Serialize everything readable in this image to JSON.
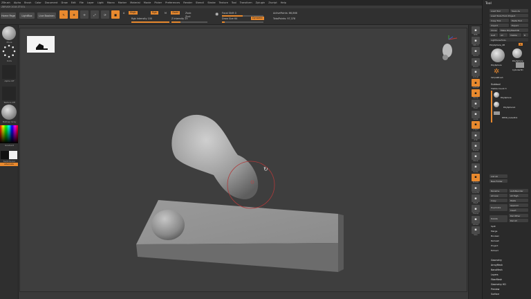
{
  "menu": [
    "ZBrush",
    "Alpha",
    "Brush",
    "Color",
    "Document",
    "Draw",
    "Edit",
    "File",
    "Layer",
    "Light",
    "Macro",
    "Marker",
    "Material",
    "Movie",
    "Picker",
    "Preferences",
    "Render",
    "Stencil",
    "Stroke",
    "Texture",
    "Tool",
    "Transform",
    "Zplugin",
    "Zscript",
    "Help"
  ],
  "title_line": "ZBRUSH 2018 ZTOOL",
  "toolbar": {
    "home_page": "Home Page",
    "lightbox": "LightBox",
    "live_boolean": "Live Boolean",
    "edit": "Edit",
    "draw": "Draw",
    "move": "Move",
    "scale": "Scale",
    "rotate": "Rotate",
    "mrgb": "Mrgb",
    "rgb": "Rgb",
    "m": "M",
    "zadd": "Zadd",
    "zsub": "Zsub",
    "zcut": "Zcut",
    "rgb_intensity": "Rgb Intensity 100",
    "z_intensity": "Z Intensity 25",
    "focal_shift": "Focal Shift 0",
    "draw_size": "Draw Size 64",
    "dynamic": "Dynamic",
    "active_points": "ActivePoints: 66,866",
    "total_points": "TotalPoints: 97,378"
  },
  "left_shelf": {
    "brush_label": "Move",
    "stroke_label": "Dots",
    "alpha_label": "Alpha Off",
    "texture_label": "Texture Off",
    "material_label": "MatCap Gray",
    "gradient_label": "Gradient",
    "switch_color": "SwitchColor",
    "alternate": "Alternate"
  },
  "right_shelf": [
    "BPR",
    "SPix 3",
    "Scroll",
    "Zoom",
    "Actual",
    "AAHalf",
    "Persp",
    "Floor",
    "Local",
    "L.Sym",
    "XYZ",
    "Frame",
    "Move",
    "Scale",
    "Rotate",
    "Line Fill",
    "PolyF",
    "Transp",
    "Ghost",
    "Solo",
    "Xpose"
  ],
  "tool_palette": {
    "title": "Tool",
    "load_tool": "Load Tool",
    "save_as": "Save As",
    "load_tools_project": "Load Tools From Project",
    "copy_tool": "Copy Tool",
    "paste_tool": "Paste Tool",
    "import": "Import",
    "export": "Export",
    "clone": "Clone",
    "make_polymesh": "Make PolyMesh3D",
    "goz": "GoZ",
    "all": "All",
    "visible": "Visible",
    "r": "R",
    "lightbox_tools": "Lightbox▸Tools",
    "polysphere": "PolySphere_48",
    "r_label": "R",
    "thumb1": "PolySphere",
    "thumb2": "PolySphere",
    "thumb3": "Cylinder3D",
    "thumb4": "SimpleBrush",
    "subtool": "Subtool",
    "visible_count": "Visible Count 3",
    "st1": "PolySphere",
    "st2": "PolySphere1",
    "st3": "PM3D_Cube3D1",
    "list_all": "List All",
    "new_folder": "New Folder",
    "rename": "Rename",
    "auto_reorder": "AutoReorder",
    "all_low": "All Low",
    "all_high": "All High",
    "copy": "Copy",
    "paste": "Paste",
    "duplicate": "Duplicate",
    "append": "Append",
    "insert": "Insert",
    "delete": "Delete",
    "del_other": "Del Other",
    "del_all": "Del All",
    "split": "Split",
    "merge": "Merge",
    "boolean": "Boolean",
    "remesh": "Remesh",
    "project": "Project",
    "extract": "Extract",
    "sections": [
      "Geometry",
      "ArrayMesh",
      "NanoMesh",
      "Layers",
      "FiberMesh",
      "Geometry HD",
      "Preview",
      "Surface"
    ]
  },
  "colors": {
    "accent": "#e8892e",
    "bg": "#3a3a3a"
  }
}
